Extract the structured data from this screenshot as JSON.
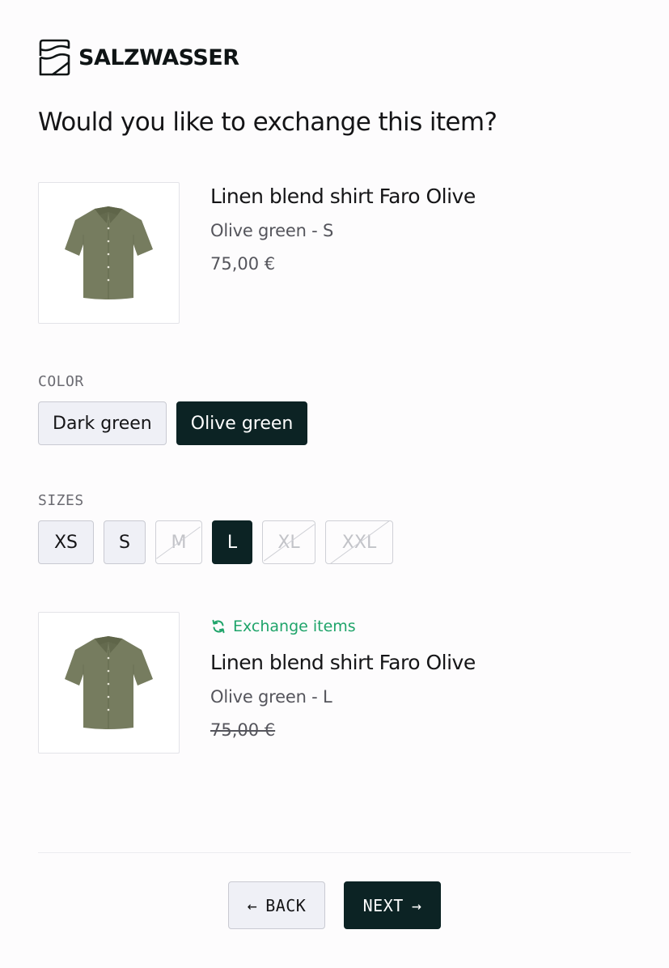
{
  "brand": {
    "name": "SALZWASSER",
    "logo_icon": "wave-square-logo"
  },
  "page": {
    "title": "Would you like to exchange this item?"
  },
  "current_item": {
    "image_icon": "shirt-image",
    "name": "Linen blend shirt Faro Olive",
    "variant": "Olive green - S",
    "price": "75,00 €"
  },
  "color_section": {
    "label": "COLOR",
    "options": [
      {
        "label": "Dark green",
        "selected": false
      },
      {
        "label": "Olive green",
        "selected": true
      }
    ]
  },
  "size_section": {
    "label": "SIZES",
    "options": [
      {
        "label": "XS",
        "state": "available"
      },
      {
        "label": "S",
        "state": "available"
      },
      {
        "label": "M",
        "state": "unavailable"
      },
      {
        "label": "L",
        "state": "selected"
      },
      {
        "label": "XL",
        "state": "unavailable"
      },
      {
        "label": "XXL",
        "state": "unavailable"
      }
    ]
  },
  "exchange_item": {
    "tag_icon": "refresh-icon",
    "tag_label": "Exchange items",
    "image_icon": "shirt-image",
    "name": "Linen blend shirt Faro Olive",
    "variant": "Olive green - L",
    "price": "75,00 €",
    "price_struck": true
  },
  "footer": {
    "back_label": "BACK",
    "back_icon": "arrow-left-icon",
    "next_label": "NEXT",
    "next_icon": "arrow-right-icon"
  },
  "colors": {
    "primary": "#0c2324",
    "accent_green": "#1fa46a",
    "chip_bg": "#eff0f6",
    "shirt_olive": "#767c5f"
  }
}
